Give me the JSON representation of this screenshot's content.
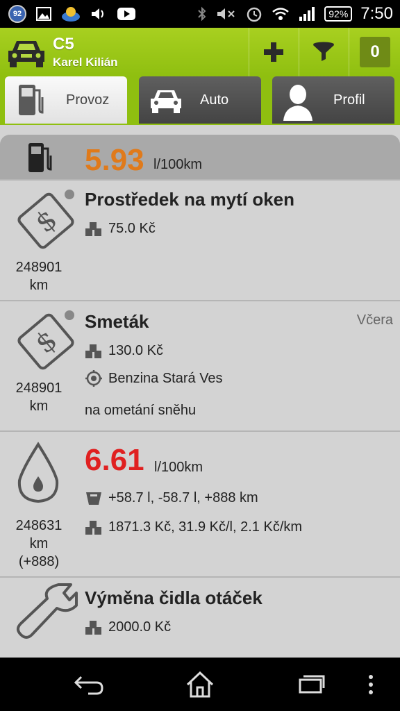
{
  "status_bar": {
    "notification_badge": "92",
    "battery": "92%",
    "time": "7:50"
  },
  "action_bar": {
    "title": "C5",
    "subtitle": "Karel Kilián",
    "count": "0"
  },
  "tabs": [
    {
      "label": "Provoz",
      "icon": "fuel-pump-icon",
      "active": true
    },
    {
      "label": "Auto",
      "icon": "car-icon",
      "active": false
    },
    {
      "label": "Profil",
      "icon": "person-icon",
      "active": false
    }
  ],
  "summary": {
    "value": "5.93",
    "unit": "l/100km",
    "color": "#e07a1a"
  },
  "entries": [
    {
      "type": "expense",
      "icon": "price-tag-icon",
      "title": "Prostředek na mytí oken",
      "price": "75.0 Kč",
      "km_value": "248901",
      "km_unit": "km"
    },
    {
      "type": "expense",
      "icon": "price-tag-icon",
      "title": "Smeták",
      "date": "Včera",
      "price": "130.0 Kč",
      "location": "Benzina Stará Ves",
      "note": "na ometání sněhu",
      "km_value": "248901",
      "km_unit": "km"
    },
    {
      "type": "refuel",
      "icon": "drop-icon",
      "consumption": "6.61",
      "unit": "l/100km",
      "consumption_color": "#e02020",
      "fuel_line": "+58.7 l, -58.7 l, +888 km",
      "cost_line": "1871.3 Kč, 31.9 Kč/l, 2.1 Kč/km",
      "km_value": "248631",
      "km_unit": "km",
      "km_delta": "(+888)"
    },
    {
      "type": "service",
      "icon": "wrench-icon",
      "title": "Výměna čidla otáček",
      "price": "2000.0 Kč"
    }
  ]
}
